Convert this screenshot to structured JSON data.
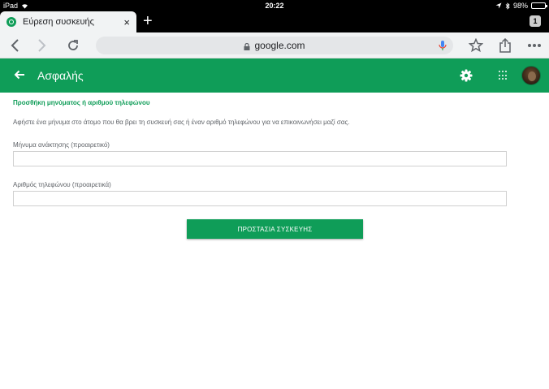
{
  "status_bar": {
    "device": "iPad",
    "time": "20:22",
    "battery": "98%"
  },
  "browser": {
    "tab": {
      "title": "Εύρεση συσκευής",
      "close": "×"
    },
    "new_tab": "+",
    "tab_count": "1",
    "url": "google.com",
    "icons": {
      "back": "back-arrow-icon",
      "forward": "forward-arrow-icon",
      "reload": "reload-icon",
      "star": "star-icon",
      "share": "share-icon",
      "menu": "more-horizontal-icon"
    }
  },
  "app_bar": {
    "title": "Ασφαλής",
    "color": "#0f9d58"
  },
  "content": {
    "heading": "Προσθήκη μηνύματος ή αριθμού τηλεφώνου",
    "description": "Αφήστε ένα μήνυμα στο άτομο που θα βρει τη συσκευή σας ή έναν αριθμό τηλεφώνου για να επικοινωνήσει μαζί σας.",
    "message_field": {
      "label": "Μήνυμα ανάκτησης (προαιρετικό)",
      "value": ""
    },
    "phone_field": {
      "label": "Αριθμός τηλεφώνου (προαιρετικά)",
      "value": ""
    },
    "submit_label": "ΠΡΟΣΤΑΣΙΑ ΣΥΣΚΕΥΗΣ"
  }
}
